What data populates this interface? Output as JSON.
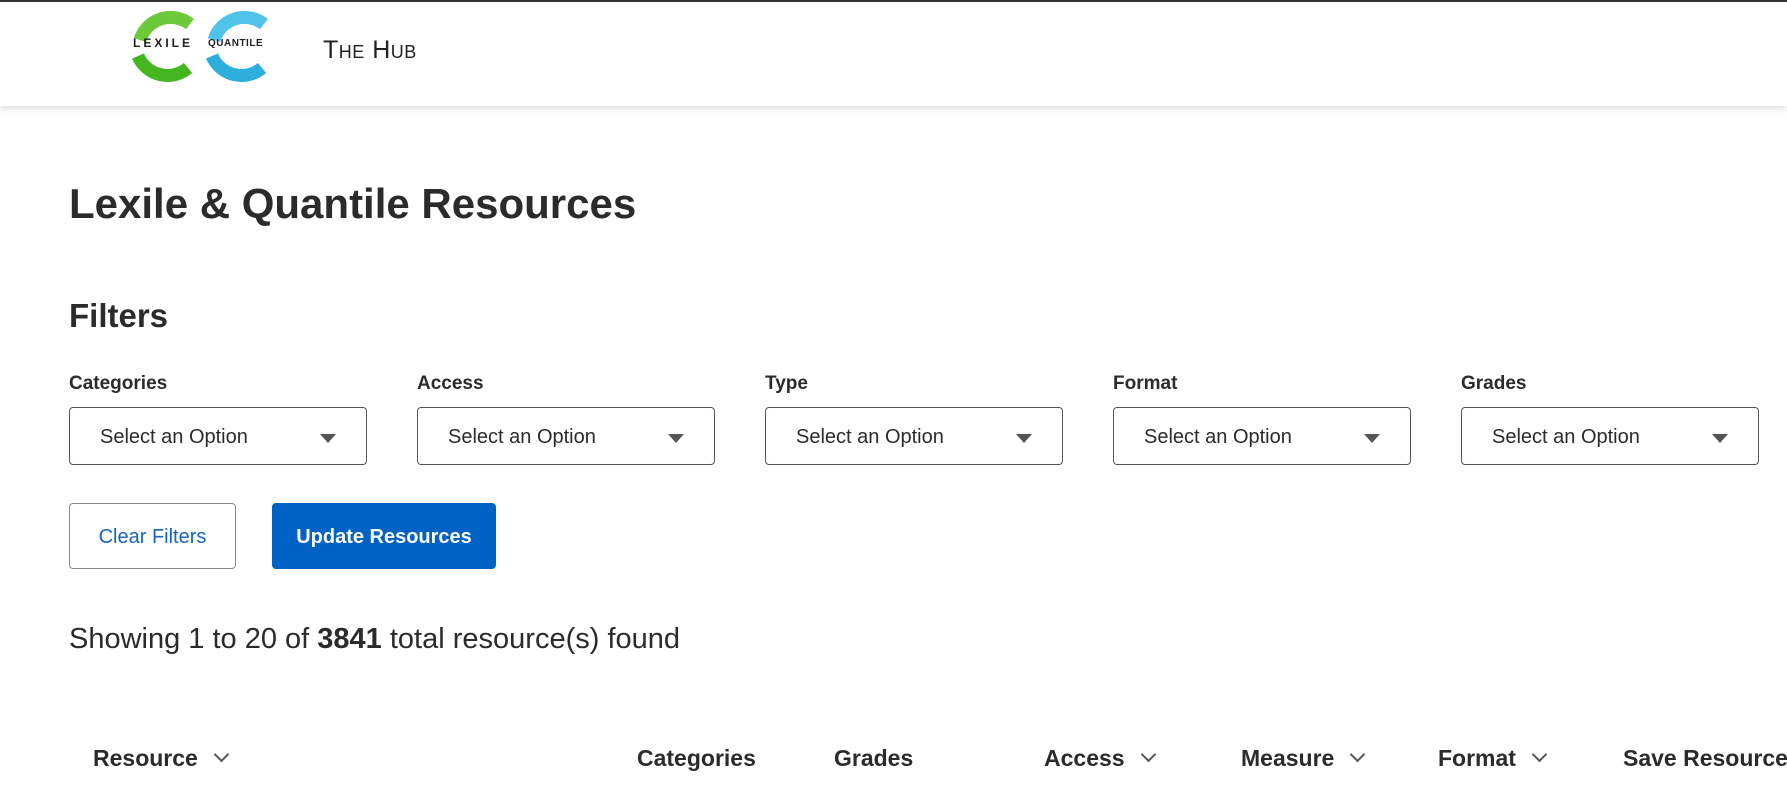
{
  "header": {
    "logo_lexile": "LEXILE",
    "logo_quantile": "QUANTILE",
    "title": "The Hub"
  },
  "page": {
    "title": "Lexile & Quantile Resources",
    "filters_heading": "Filters"
  },
  "filters": [
    {
      "label": "Categories",
      "value": "Select an Option"
    },
    {
      "label": "Access",
      "value": "Select an Option"
    },
    {
      "label": "Type",
      "value": "Select an Option"
    },
    {
      "label": "Format",
      "value": "Select an Option"
    },
    {
      "label": "Grades",
      "value": "Select an Option"
    }
  ],
  "buttons": {
    "clear": "Clear Filters",
    "update": "Update Resources"
  },
  "results": {
    "prefix": "Showing 1 to 20 of",
    "total": "3841",
    "suffix": "total resource(s) found"
  },
  "table": {
    "columns": [
      {
        "label": "Resource",
        "sortable": true
      },
      {
        "label": "Categories",
        "sortable": false
      },
      {
        "label": "Grades",
        "sortable": false
      },
      {
        "label": "Access",
        "sortable": true
      },
      {
        "label": "Measure",
        "sortable": true
      },
      {
        "label": "Format",
        "sortable": true
      },
      {
        "label": "Save Resource",
        "sortable": false
      }
    ]
  },
  "colors": {
    "primary_button": "#0062c4",
    "link": "#1565c0",
    "lexile_green": "#4cc02d",
    "quantile_blue": "#3fbde6"
  }
}
